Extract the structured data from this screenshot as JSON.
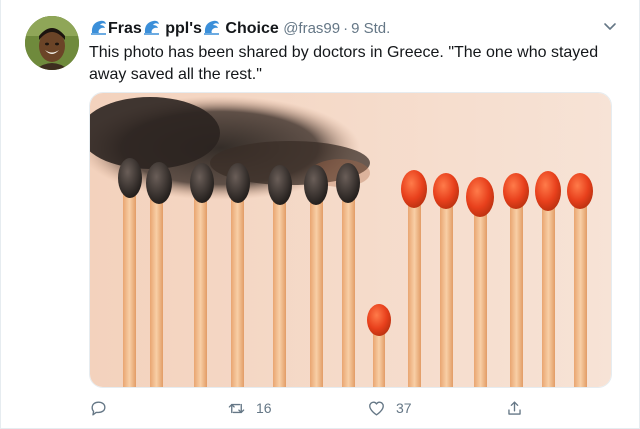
{
  "tweet": {
    "display_name_parts": [
      "Fras",
      "ppl's",
      "Choice"
    ],
    "handle": "@fras99",
    "separator": "·",
    "time": "9 Std.",
    "text": "This photo has been shared by doctors in Greece. \"The one who stayed away saved all the rest.\"",
    "media_description_icon": "image-icon",
    "actions": {
      "reply_count": "",
      "retweet_count": "16",
      "like_count": "37",
      "share_count": ""
    }
  },
  "icons": {
    "name_emoji": "water-wave-icon",
    "menu": "chevron-down-icon",
    "reply": "reply-icon",
    "retweet": "retweet-icon",
    "like": "heart-icon",
    "share": "share-icon"
  },
  "colors": {
    "text_primary": "#14171a",
    "text_secondary": "#657786",
    "border": "#e6ecf0",
    "wave_blue": "#3b8fd9",
    "match_head_red": "#e8401c",
    "match_head_burnt": "#2a2420",
    "match_stick": "#f0b889"
  }
}
